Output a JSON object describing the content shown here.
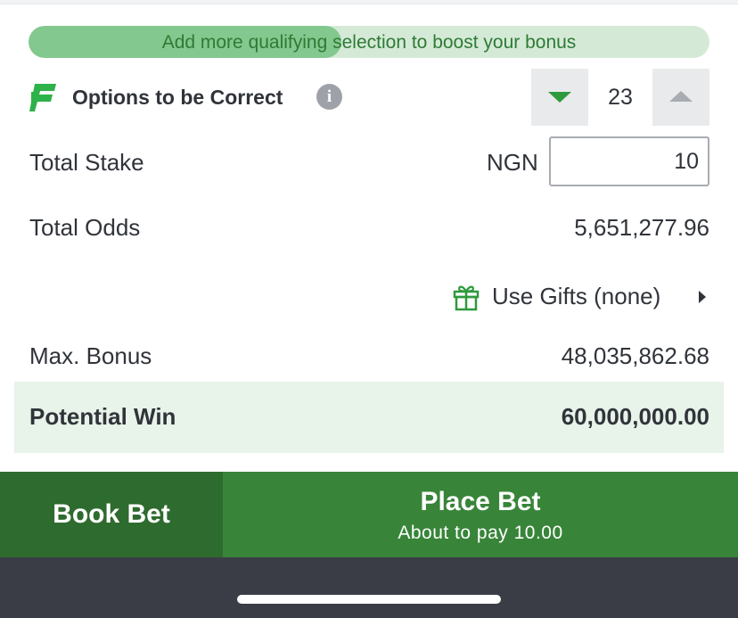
{
  "boost": {
    "text": "Add more qualifying selection to boost your bonus",
    "progress_fraction": 0.46
  },
  "options": {
    "label": "Options to be Correct",
    "info_icon": "info-icon",
    "count": "23"
  },
  "stake": {
    "label": "Total Stake",
    "currency": "NGN",
    "value": "10"
  },
  "odds": {
    "label": "Total Odds",
    "value": "5,651,277.96"
  },
  "gifts": {
    "label": "Use Gifts (none)",
    "icon": "gift-icon"
  },
  "bonus": {
    "label": "Max. Bonus",
    "value": "48,035,862.68"
  },
  "potential_win": {
    "label": "Potential Win",
    "value": "60,000,000.00"
  },
  "actions": {
    "book_bet": "Book Bet",
    "place_bet": "Place Bet",
    "place_bet_sub": "About to pay 10.00"
  },
  "colors": {
    "brand_green": "#388539",
    "dark_green": "#2e6b2e",
    "highlight_bg": "#e8f3e9"
  }
}
